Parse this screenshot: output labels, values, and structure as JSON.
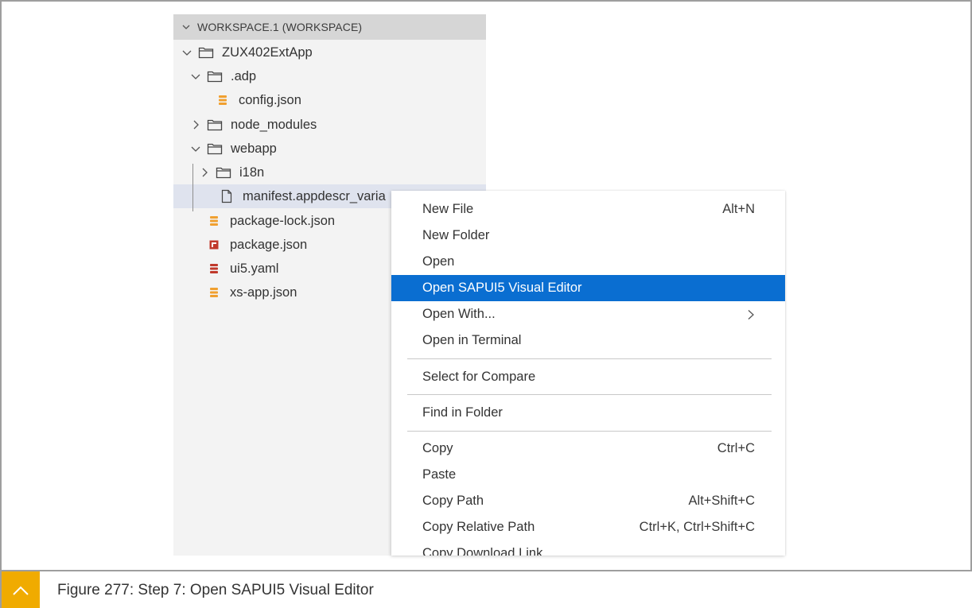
{
  "explorer": {
    "workspace_title": "WORKSPACE.1 (WORKSPACE)",
    "items": [
      {
        "label": "ZUX402ExtApp",
        "icon": "folder-icon",
        "expanded": true
      },
      {
        "label": ".adp",
        "icon": "folder-icon",
        "expanded": true
      },
      {
        "label": "config.json",
        "icon": "json-file-icon"
      },
      {
        "label": "node_modules",
        "icon": "folder-icon",
        "expanded": false
      },
      {
        "label": "webapp",
        "icon": "folder-icon",
        "expanded": true
      },
      {
        "label": "i18n",
        "icon": "folder-icon",
        "expanded": false
      },
      {
        "label": "manifest.appdescr_varia",
        "icon": "file-icon",
        "selected": true
      },
      {
        "label": "package-lock.json",
        "icon": "json-file-icon"
      },
      {
        "label": "package.json",
        "icon": "npm-icon"
      },
      {
        "label": "ui5.yaml",
        "icon": "yaml-file-icon"
      },
      {
        "label": "xs-app.json",
        "icon": "json-file-icon"
      }
    ]
  },
  "context_menu": {
    "items": [
      {
        "label": "New File",
        "shortcut": "Alt+N"
      },
      {
        "label": "New Folder",
        "shortcut": ""
      },
      {
        "label": "Open",
        "shortcut": ""
      },
      {
        "label": "Open SAPUI5 Visual Editor",
        "shortcut": "",
        "highlighted": true
      },
      {
        "label": "Open With...",
        "shortcut": "",
        "submenu": true
      },
      {
        "label": "Open in Terminal",
        "shortcut": ""
      },
      {
        "label": "Select for Compare",
        "shortcut": ""
      },
      {
        "label": "Find in Folder",
        "shortcut": ""
      },
      {
        "label": "Copy",
        "shortcut": "Ctrl+C"
      },
      {
        "label": "Paste",
        "shortcut": ""
      },
      {
        "label": "Copy Path",
        "shortcut": "Alt+Shift+C"
      },
      {
        "label": "Copy Relative Path",
        "shortcut": "Ctrl+K, Ctrl+Shift+C"
      },
      {
        "label": "Copy Download Link",
        "shortcut": ""
      }
    ]
  },
  "caption": {
    "text": "Figure 277: Step 7: Open SAPUI5 Visual Editor",
    "badge_icon": "chevron-up-icon"
  },
  "colors": {
    "highlight": "#0a6ed1",
    "badge": "#f0ab00",
    "json_icon": "#f0a030",
    "npm_icon": "#c0392b",
    "yaml_icon": "#c0392b",
    "selected_row": "#dfe3ee"
  }
}
